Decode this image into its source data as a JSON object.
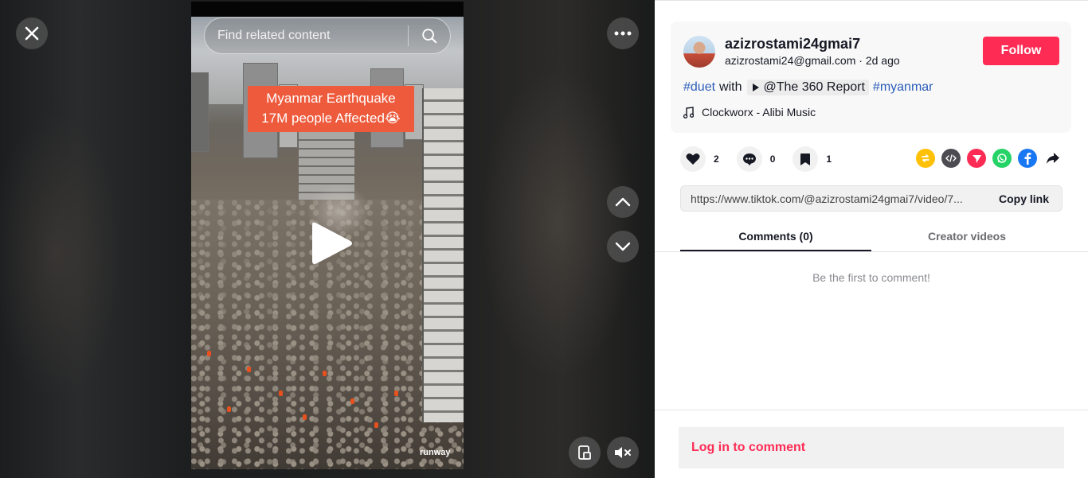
{
  "video": {
    "search_placeholder": "Find related content",
    "caption_line1": "Myanmar Earthquake",
    "caption_line2": "17M people Affected😭",
    "watermark": "runway",
    "icons": {
      "close": "close-icon",
      "more": "more-icon",
      "search": "search-icon",
      "play": "play-icon",
      "up": "chevron-up-icon",
      "down": "chevron-down-icon",
      "pip": "picture-in-picture-icon",
      "mute": "mute-icon"
    }
  },
  "author": {
    "username": "azizrostami24gmai7",
    "handle": "azizrostami24@gmail.com",
    "separator": " · ",
    "posted": "2d ago",
    "follow_label": "Follow"
  },
  "description": {
    "tag1": "#duet",
    "with_text": "with",
    "mention": "@The 360 Report",
    "tag2": "#myanmar"
  },
  "music": {
    "title": "Clockworx - Alibi Music"
  },
  "stats": {
    "likes": "2",
    "comments": "0",
    "saves": "1"
  },
  "share_icons": [
    "repost-icon",
    "embed-icon",
    "send-icon",
    "whatsapp-icon",
    "facebook-icon",
    "share-arrow-icon"
  ],
  "link": {
    "url": "https://www.tiktok.com/@azizrostami24gmai7/video/7...",
    "copy_label": "Copy link"
  },
  "tabs": {
    "comments": "Comments (0)",
    "creator": "Creator videos"
  },
  "comments": {
    "empty": "Be the first to comment!",
    "login": "Log in to comment"
  },
  "colors": {
    "brand": "#fe2c55",
    "hashtag": "#2b5db9",
    "caption_bg": "#ee5a3c"
  }
}
